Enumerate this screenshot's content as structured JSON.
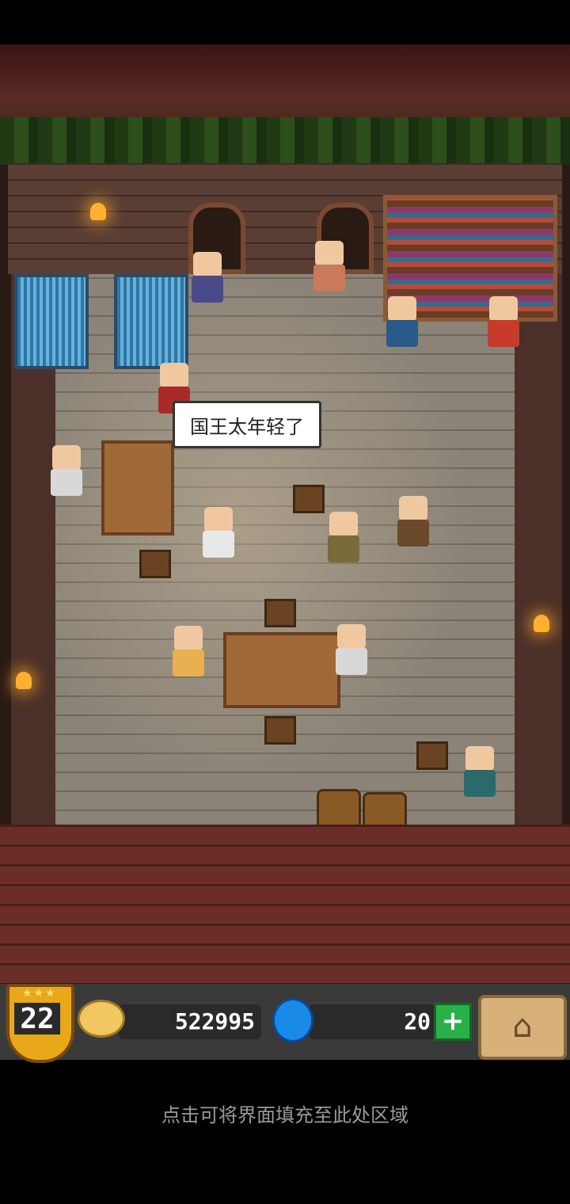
{
  "speech": {
    "text": "国王太年轻了"
  },
  "hud": {
    "level": "22",
    "level_stars": "★★★",
    "coins": "522995",
    "gems": "20",
    "plus_label": "+",
    "home_icon": "⌂"
  },
  "fill_hint": "点击可将界面填充至此处区域",
  "colors": {
    "hud_bg": "#3a3a3a",
    "badge": "#e8a81a",
    "plus": "#2ab04a",
    "gem": "#1a8ae8"
  },
  "icons": [
    "coin-icon",
    "gem-icon",
    "plus-icon",
    "home-icon",
    "level-badge-icon"
  ]
}
